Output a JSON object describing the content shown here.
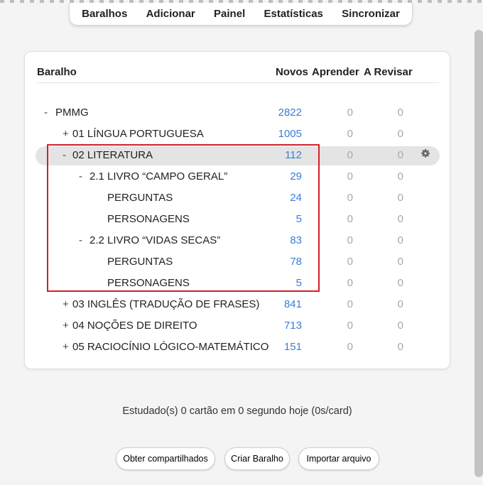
{
  "toolbar": {
    "decks": "Baralhos",
    "add": "Adicionar",
    "panel": "Painel",
    "stats": "Estatísticas",
    "sync": "Sincronizar"
  },
  "table_headers": {
    "deck": "Baralho",
    "new": "Novos",
    "learn": "Aprender",
    "review": "A Revisar"
  },
  "decks": [
    {
      "toggle": "-",
      "name": "PMMG",
      "new": "2822",
      "learn": "0",
      "review": "0"
    },
    {
      "toggle": "+",
      "name": "01 LÍNGUA PORTUGUESA",
      "new": "1005",
      "learn": "0",
      "review": "0"
    },
    {
      "toggle": "-",
      "name": "02 LITERATURA",
      "new": "112",
      "learn": "0",
      "review": "0"
    },
    {
      "toggle": "-",
      "name": "2.1 LIVRO “CAMPO GERAL”",
      "new": "29",
      "learn": "0",
      "review": "0"
    },
    {
      "toggle": "",
      "name": "PERGUNTAS",
      "new": "24",
      "learn": "0",
      "review": "0"
    },
    {
      "toggle": "",
      "name": "PERSONAGENS",
      "new": "5",
      "learn": "0",
      "review": "0"
    },
    {
      "toggle": "-",
      "name": "2.2 LIVRO “VIDAS SECAS”",
      "new": "83",
      "learn": "0",
      "review": "0"
    },
    {
      "toggle": "",
      "name": "PERGUNTAS",
      "new": "78",
      "learn": "0",
      "review": "0"
    },
    {
      "toggle": "",
      "name": "PERSONAGENS",
      "new": "5",
      "learn": "0",
      "review": "0"
    },
    {
      "toggle": "+",
      "name": "03 INGLÊS (TRADUÇÃO DE FRASES)",
      "new": "841",
      "learn": "0",
      "review": "0"
    },
    {
      "toggle": "+",
      "name": "04 NOÇÕES DE DIREITO",
      "new": "713",
      "learn": "0",
      "review": "0"
    },
    {
      "toggle": "+",
      "name": "05 RACIOCÍNIO LÓGICO-MATEMÁTICO",
      "new": "151",
      "learn": "0",
      "review": "0"
    }
  ],
  "studied_text": "Estudado(s) 0 cartão em 0 segundo hoje (0s/card)",
  "buttons": {
    "shared": "Obter compartilhados",
    "create": "Criar Baralho",
    "import": "Importar arquivo"
  },
  "colors": {
    "new_count": "#3a7dd8",
    "zero_count": "#a8a8a8",
    "highlight_box": "#d2202a"
  }
}
